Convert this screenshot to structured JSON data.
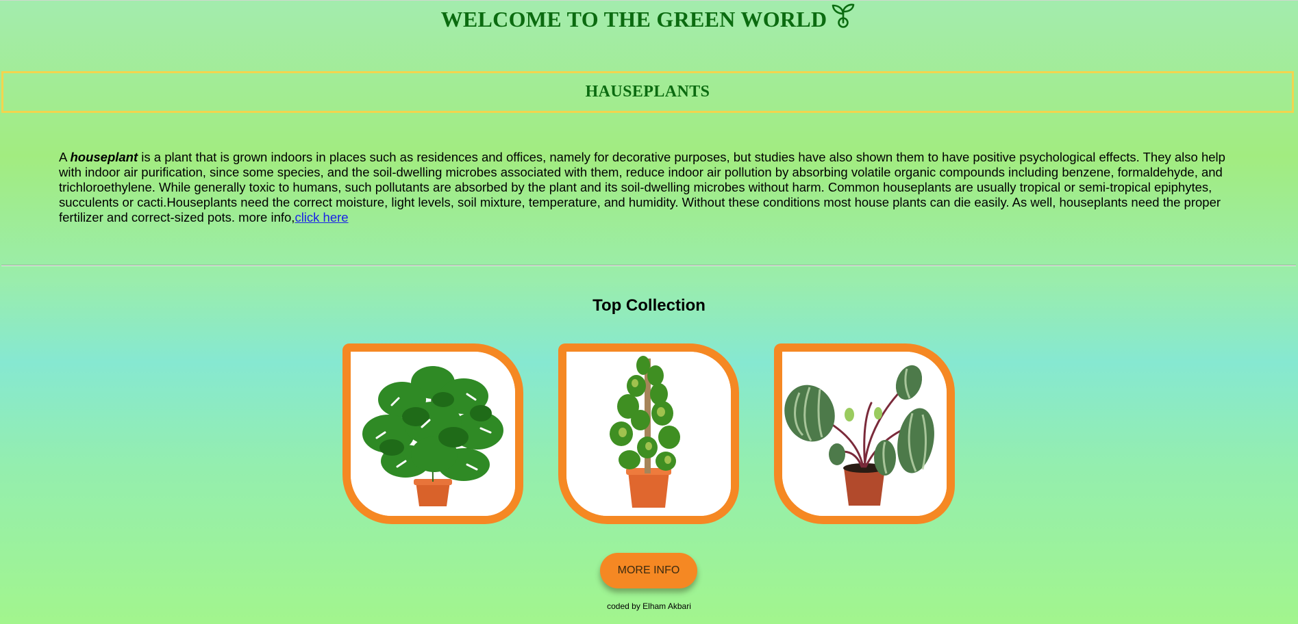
{
  "header": {
    "title": "WELCOME TO THE GREEN WORLD",
    "icon": "sprout-icon",
    "color": "#0b6b10"
  },
  "section": {
    "title": "HAUSEPLANTS",
    "border_color": "#f3d44e"
  },
  "intro": {
    "lead": "A ",
    "term": "houseplant",
    "body": " is a plant that is grown indoors in places such as residences and offices, namely for decorative purposes, but studies have also shown them to have positive psychological effects. They also help with indoor air purification, since some species, and the soil-dwelling microbes associated with them, reduce indoor air pollution by absorbing volatile organic compounds including benzene, formaldehyde, and trichloroethylene. While generally toxic to humans, such pollutants are absorbed by the plant and its soil-dwelling microbes without harm. Common houseplants are usually tropical or semi-tropical epiphytes, succulents or cacti.Houseplants need the correct moisture, light levels, soil mixture, temperature, and humidity. Without these conditions most house plants can die easily. As well, houseplants need the proper fertilizer and correct-sized pots. more info,",
    "link_label": "click here"
  },
  "collection": {
    "title": "Top Collection",
    "items": [
      {
        "name": "monstera-plant-image"
      },
      {
        "name": "pothos-totem-plant-image"
      },
      {
        "name": "watermelon-peperomia-plant-image"
      }
    ],
    "frame_color": "#f58823"
  },
  "button": {
    "label": "MORE INFO"
  },
  "footer": {
    "credit": "coded by Elham Akbari"
  }
}
